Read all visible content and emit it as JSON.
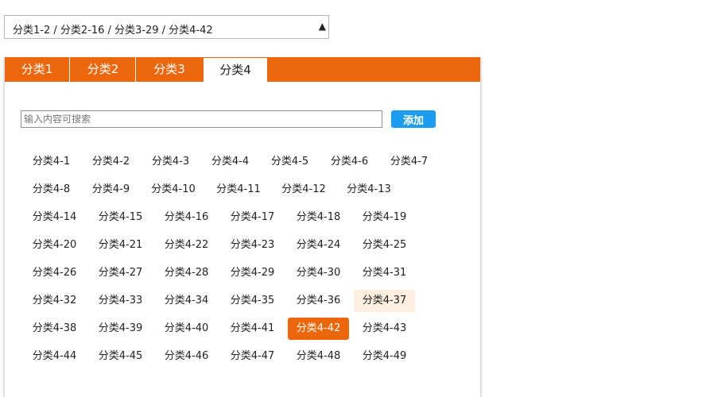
{
  "select": {
    "value": "分类1-2 / 分类2-16 / 分类3-29 / 分类4-42",
    "arrow": "▲"
  },
  "tabs": [
    {
      "label": "分类1",
      "active": false
    },
    {
      "label": "分类2",
      "active": false
    },
    {
      "label": "分类3",
      "active": false
    },
    {
      "label": "分类4",
      "active": true
    }
  ],
  "search": {
    "placeholder": "输入内容可搜索",
    "value": ""
  },
  "add_button": {
    "label": "添加"
  },
  "colors": {
    "accent": "#ec670c",
    "button_blue": "#1a9cf0",
    "hover_bg": "#fdefdf"
  },
  "selected_tag": "分类4-42",
  "hovered_tag": "分类4-37",
  "tag_rows": [
    [
      "分类4-1",
      "分类4-2",
      "分类4-3",
      "分类4-4",
      "分类4-5",
      "分类4-6",
      "分类4-7"
    ],
    [
      "分类4-8",
      "分类4-9",
      "分类4-10",
      "分类4-11",
      "分类4-12",
      "分类4-13"
    ],
    [
      "分类4-14",
      "分类4-15",
      "分类4-16",
      "分类4-17",
      "分类4-18",
      "分类4-19"
    ],
    [
      "分类4-20",
      "分类4-21",
      "分类4-22",
      "分类4-23",
      "分类4-24",
      "分类4-25"
    ],
    [
      "分类4-26",
      "分类4-27",
      "分类4-28",
      "分类4-29",
      "分类4-30",
      "分类4-31"
    ],
    [
      "分类4-32",
      "分类4-33",
      "分类4-34",
      "分类4-35",
      "分类4-36",
      "分类4-37"
    ],
    [
      "分类4-38",
      "分类4-39",
      "分类4-40",
      "分类4-41",
      "分类4-42",
      "分类4-43"
    ],
    [
      "分类4-44",
      "分类4-45",
      "分类4-46",
      "分类4-47",
      "分类4-48",
      "分类4-49"
    ]
  ]
}
